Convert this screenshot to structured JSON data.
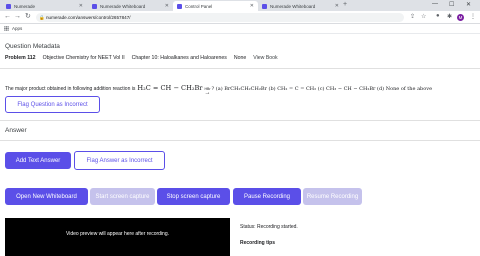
{
  "browser": {
    "tabs": [
      {
        "title": "Numerade",
        "icon": "numerade-icon"
      },
      {
        "title": "Numerade Whiteboard",
        "icon": "numerade-icon"
      },
      {
        "title": "Control Panel",
        "icon": "control-panel-icon"
      },
      {
        "title": "Numerade Whiteboard",
        "icon": "numerade-icon"
      }
    ],
    "url": "numerade.com/answers/control/2657847/",
    "avatar_letter": "M",
    "bookmarks": {
      "apps_label": "Apps"
    }
  },
  "page": {
    "metadata_title": "Question Metadata",
    "problem": "Problem 112",
    "book": "Objective Chemistry for NEET Vol II",
    "chapter": "Chapter 10: Haloalkanes and Haloarenes",
    "section": "None",
    "view_book": "View Book",
    "question": {
      "prefix": "The major product obtained in following addition reaction is",
      "reactant": "H₂C = CH − CH₂Br",
      "arrow": "→",
      "reagent": "HBr",
      "rest": "? (a) BrCH₂CH₂CH₂Br (b) CH₂ = C = CH₂ (c) CH₃ − CH − CH₂Br (d) None of the above"
    },
    "flag_question_label": "Flag Question as Incorrect",
    "answer_label": "Answer",
    "add_text_answer_label": "Add Text Answer",
    "flag_answer_label": "Flag Answer as Incorrect",
    "controls": {
      "open_whiteboard": "Open New Whiteboard",
      "start_capture": "Start screen capture",
      "stop_capture": "Stop screen capture",
      "pause_recording": "Pause Recording",
      "resume_recording": "Resume Recording"
    },
    "preview_text": "Video preview will appear here after recording.",
    "status": "Status: Recording started.",
    "recording_tips": "Recording tips"
  },
  "colors": {
    "brand": "#5b4fe8",
    "disabled": "#c5c2ec"
  }
}
